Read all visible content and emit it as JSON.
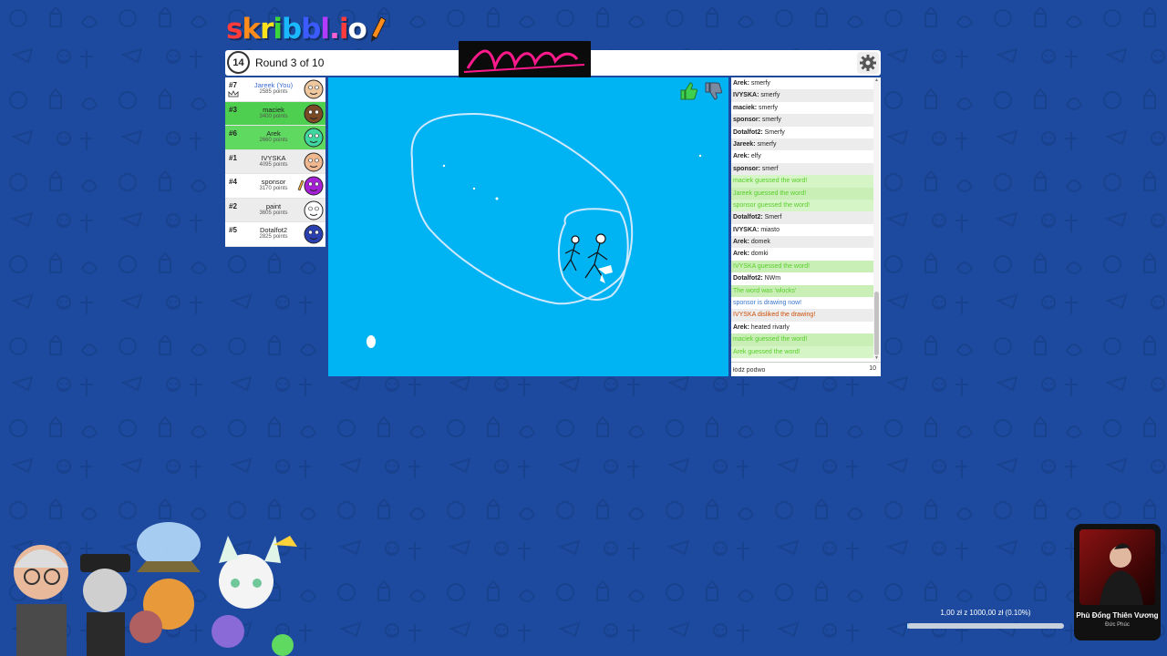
{
  "logo": {
    "letters": [
      {
        "char": "s",
        "color": "#ff3b3b"
      },
      {
        "char": "k",
        "color": "#ff8c1a"
      },
      {
        "char": "r",
        "color": "#ffe21a"
      },
      {
        "char": "i",
        "color": "#3bd63b"
      },
      {
        "char": "b",
        "color": "#1ab8ff"
      },
      {
        "char": "b",
        "color": "#3b5bff"
      },
      {
        "char": "l",
        "color": "#b23bff"
      },
      {
        "char": ".",
        "color": "#ff5fd0"
      },
      {
        "char": "i",
        "color": "#ff3b3b"
      },
      {
        "char": "o",
        "color": "#ffffff"
      }
    ]
  },
  "game": {
    "timer": "14",
    "round_text": "Round 3 of 10"
  },
  "players": [
    {
      "rank": "#7",
      "name": "Jareek (You)",
      "points": "2585 points",
      "you": true,
      "guessed": false,
      "crown": true,
      "drawing": false,
      "avatar_color": "#f0c8a0"
    },
    {
      "rank": "#3",
      "name": "maciek",
      "points": "3400 points",
      "you": false,
      "guessed": true,
      "crown": false,
      "drawing": false,
      "avatar_color": "#7a4a24"
    },
    {
      "rank": "#6",
      "name": "Arek",
      "points": "2660 points",
      "you": false,
      "guessed": true,
      "crown": false,
      "drawing": false,
      "avatar_color": "#3fd6a0"
    },
    {
      "rank": "#1",
      "name": "IVYSKA",
      "points": "4095 points",
      "you": false,
      "guessed": false,
      "crown": false,
      "drawing": false,
      "avatar_color": "#f0b890"
    },
    {
      "rank": "#4",
      "name": "sponsor",
      "points": "3170 points",
      "you": false,
      "guessed": false,
      "crown": false,
      "drawing": true,
      "avatar_color": "#a61fd6"
    },
    {
      "rank": "#2",
      "name": "paint",
      "points": "3605 points",
      "you": false,
      "guessed": false,
      "crown": false,
      "drawing": false,
      "avatar_color": "#ffffff"
    },
    {
      "rank": "#5",
      "name": "Dotalfot2",
      "points": "2825 points",
      "you": false,
      "guessed": false,
      "crown": false,
      "drawing": false,
      "avatar_color": "#2a3fb0"
    }
  ],
  "chat": {
    "messages": [
      {
        "author": "Arek",
        "text": "smerfy",
        "type": "normal"
      },
      {
        "author": "IVYSKA",
        "text": "smerfy",
        "type": "normal"
      },
      {
        "author": "maciek",
        "text": "smerfy",
        "type": "normal"
      },
      {
        "author": "sponsor",
        "text": "smerfy",
        "type": "normal"
      },
      {
        "author": "Dotalfot2",
        "text": "Smerfy",
        "type": "normal"
      },
      {
        "author": "Jareek",
        "text": "smerfy",
        "type": "normal"
      },
      {
        "author": "Arek",
        "text": "elfy",
        "type": "normal"
      },
      {
        "author": "sponsor",
        "text": "smerf",
        "type": "normal"
      },
      {
        "author": "",
        "text": "maciek guessed the word!",
        "type": "green"
      },
      {
        "author": "",
        "text": "Jareek guessed the word!",
        "type": "green"
      },
      {
        "author": "",
        "text": "sponsor guessed the word!",
        "type": "green"
      },
      {
        "author": "Dotalfot2",
        "text": "Smerf",
        "type": "normal"
      },
      {
        "author": "IVYSKA",
        "text": "miasto",
        "type": "normal"
      },
      {
        "author": "Arek",
        "text": "domek",
        "type": "normal"
      },
      {
        "author": "Arek",
        "text": "domki",
        "type": "normal"
      },
      {
        "author": "",
        "text": "IVYSKA guessed the word!",
        "type": "green"
      },
      {
        "author": "Dotalfot2",
        "text": "NWm",
        "type": "normal"
      },
      {
        "author": "",
        "text": "The word was 'wlocks'",
        "type": "green"
      },
      {
        "author": "",
        "text": "sponsor is drawing now!",
        "type": "blue"
      },
      {
        "author": "",
        "text": "IVYSKA disliked the drawing!",
        "type": "red"
      },
      {
        "author": "Arek",
        "text": "heated rivarly",
        "type": "normal"
      },
      {
        "author": "",
        "text": "maciek guessed the word!",
        "type": "green"
      },
      {
        "author": "",
        "text": "Arek guessed the word!",
        "type": "green"
      }
    ],
    "input_value": "łódź podwo",
    "char_count": "10"
  },
  "donation": {
    "text": "1,00 zł z 1000,00 zł (0.10%)",
    "progress": 0.001
  },
  "music": {
    "title": "Phù Đổng Thiên Vương",
    "artist": "Đức Phúc"
  },
  "colors": {
    "background": "#1d4a9e",
    "canvas": "#00b3f2",
    "guessed_row": "#5fd95f",
    "chat_green": "#56ce27",
    "chat_blue": "#3975ce",
    "chat_red": "#ce4f0a"
  }
}
